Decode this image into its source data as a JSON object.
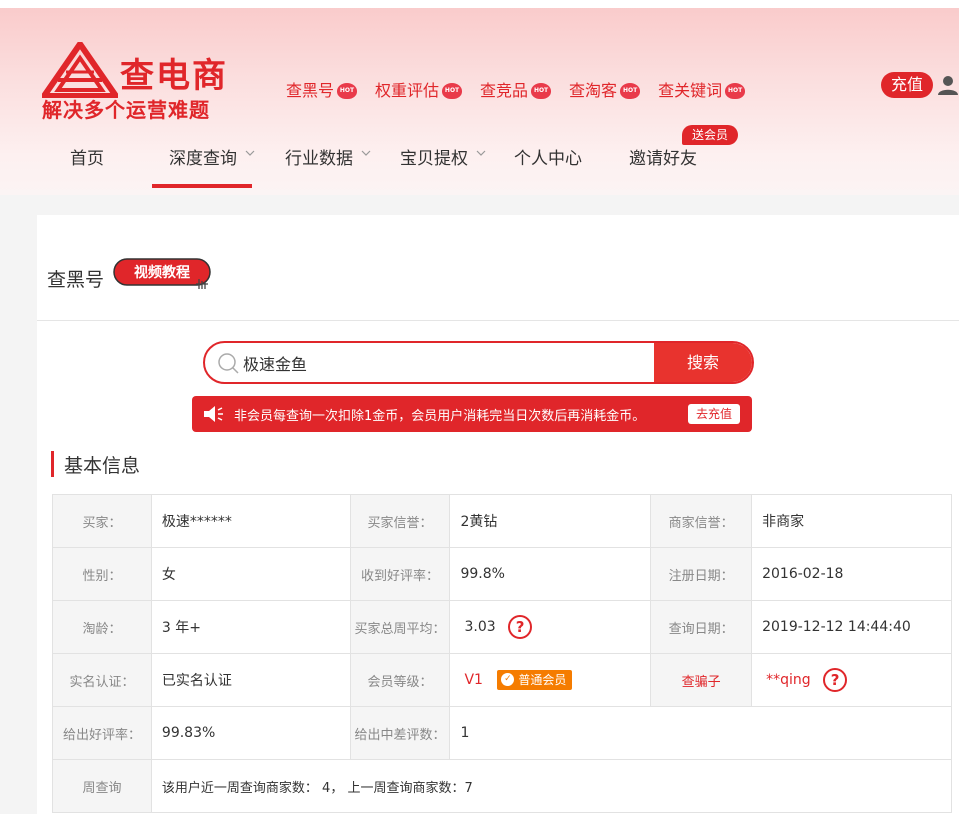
{
  "brand": {
    "name": "查电商",
    "slogan": "解决多个运营难题"
  },
  "quick_links": [
    {
      "label": "查黑号",
      "badge": "HOT"
    },
    {
      "label": "权重评估",
      "badge": "HOT"
    },
    {
      "label": "查竞品",
      "badge": "HOT"
    },
    {
      "label": "查淘客",
      "badge": "HOT"
    },
    {
      "label": "查关键词",
      "badge": "HOT"
    }
  ],
  "header": {
    "recharge_label": "充值"
  },
  "nav": {
    "items": [
      {
        "label": "首页"
      },
      {
        "label": "深度查询"
      },
      {
        "label": "行业数据"
      },
      {
        "label": "宝贝提权"
      },
      {
        "label": "个人中心"
      },
      {
        "label": "邀请好友"
      }
    ],
    "active": "深度查询",
    "vip_tag": "送会员"
  },
  "page": {
    "title": "查黑号",
    "video_badge": "视频教程"
  },
  "search": {
    "value": "极速金鱼",
    "button_label": "搜索"
  },
  "notice": {
    "text": "非会员每查询一次扣除1金币，会员用户消耗完当日次数后再消耗金币。",
    "button_label": "去充值"
  },
  "section": {
    "title": "基本信息"
  },
  "info": {
    "buyer_label": "买家：",
    "buyer_value": "极速******",
    "buyer_credit_label": "买家信誉：",
    "buyer_credit_value": "2黄钻",
    "seller_credit_label": "商家信誉：",
    "seller_credit_value": "非商家",
    "gender_label": "性别：",
    "gender_value": "女",
    "good_rate_label": "收到好评率：",
    "good_rate_value": "99.8%",
    "register_label": "注册日期：",
    "register_value": "2016-02-18",
    "age_label": "淘龄：",
    "age_value": "3 年+",
    "weekly_avg_label": "买家总周平均：",
    "weekly_avg_value": "3.03",
    "query_date_label": "查询日期：",
    "query_date_value": "2019-12-12 14:44:40",
    "realname_label": "实名认证：",
    "realname_value": "已实名认证",
    "member_level_label": "会员等级：",
    "member_level_value": "V1",
    "member_badge": "普通会员",
    "fraud_label": "查骗子",
    "fraud_value": "**qing",
    "given_good_label": "给出好评率：",
    "given_good_value": "99.83%",
    "given_bad_label": "给出中差评数：",
    "given_bad_value": "1",
    "weekly_query_label": "周查询",
    "weekly_query_value": "该用户近一周查询商家数： 4， 上一周查询商家数：7"
  },
  "colors": {
    "brand_red": "#e0262a",
    "badge_orange": "#f57c00"
  }
}
